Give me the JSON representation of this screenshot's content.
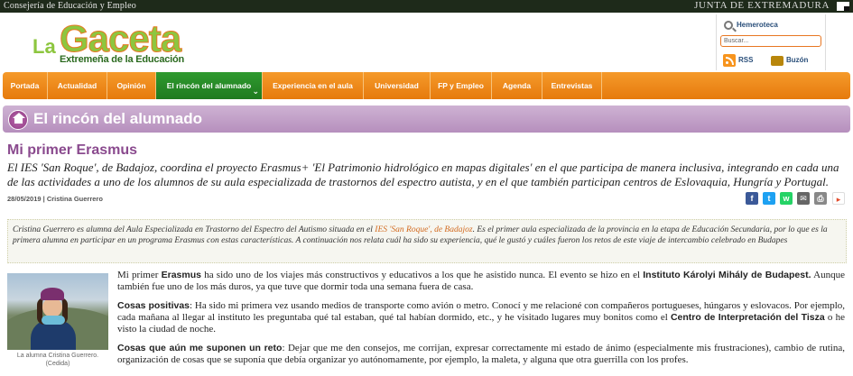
{
  "header": {
    "consejeria": "Consejería de Educación y Empleo",
    "junta": "JUNTA DE EXTREMADURA",
    "logo_la": "La",
    "logo_gaceta": "Gaceta",
    "logo_sub": "Extremeña de la Educación"
  },
  "tools": {
    "hemeroteca": "Hemeroteca",
    "search_placeholder": "Buscar...",
    "rss": "RSS",
    "buzon": "Buzón"
  },
  "nav": [
    {
      "label": "Portada"
    },
    {
      "label": "Actualidad"
    },
    {
      "label": "Opinión"
    },
    {
      "label": "El rincón del alumnado"
    },
    {
      "label": "Experiencia en el aula"
    },
    {
      "label": "Universidad"
    },
    {
      "label": "FP y Empleo"
    },
    {
      "label": "Agenda"
    },
    {
      "label": "Entrevistas"
    }
  ],
  "section": {
    "title": "El rincón del alumnado"
  },
  "article": {
    "title": "Mi primer Erasmus",
    "lead": "El IES 'San Roque', de Badajoz, coordina el proyecto Erasmus+ 'El Patrimonio hidrológico en mapas digitales' en el que participa de manera inclusiva, integrando en cada una de las actividades a uno de los alumnos de su aula especializada de trastornos del espectro autista, y en el que también participan centros de Eslovaquia, Hungría y Portugal.",
    "date": "28/05/2019",
    "separator": " | ",
    "author": "Cristina Guerrero",
    "intro_a": "Cristina Guerrero es alumna del Aula Especializada en Trastorno del Espectro del Autismo situada en el ",
    "intro_link": "IES 'San Roque', de Badajoz",
    "intro_b": ". Es el primer aula especializada de la provincia en la etapa de Educación Secundaria, por lo que es la primera alumna en participar en un programa Erasmus con estas características. A continuación nos relata cuál ha sido su experiencia, qué le gustó y cuáles fueron los retos de este viaje de intercambio celebrado en Budapes",
    "caption": "La alumna Cristina Guerrero. (Cedida)",
    "p1_a": "Mi primer ",
    "p1_b1": "Erasmus",
    "p1_c": " ha sido uno de los viajes más constructivos y educativos a los que he asistido nunca. El evento se hizo en el ",
    "p1_b2": "Instituto Károlyi Mihály de Budapest.",
    "p1_d": " Aunque también fue uno de los más duros, ya que tuve que dormir toda una semana fuera de casa.",
    "p2_b": "Cosas positivas",
    "p2_a": ": Ha sido mi primera vez usando medios de transporte como avión o metro. Conocí y me relacioné con compañeros portugueses, húngaros y eslovacos. Por ejemplo, cada mañana al llegar al instituto les preguntaba qué tal estaban, qué tal habían dormido, etc., y he visitado lugares muy bonitos como el ",
    "p2_b2": "Centro de Interpretación del Tisza",
    "p2_c": " o he visto la ciudad de noche.",
    "p3_b": "Cosas que aún me suponen un reto",
    "p3_a": ": Dejar que me den consejos, me corrijan, expresar correctamente mi estado de ánimo (especialmente mis frustraciones), cambio de rutina, organización de cosas que se suponía que debía organizar yo autónomamente, por ejemplo, la maleta, y alguna que otra guerrilla con los profes."
  },
  "social": [
    {
      "icon": "facebook-icon",
      "color": "#3b5998",
      "glyph": "f"
    },
    {
      "icon": "twitter-icon",
      "color": "#1da1f2",
      "glyph": "t"
    },
    {
      "icon": "whatsapp-icon",
      "color": "#25d366",
      "glyph": "w"
    },
    {
      "icon": "email-icon",
      "color": "#666666",
      "glyph": "✉"
    },
    {
      "icon": "print-icon",
      "color": "#888888",
      "glyph": "⎙"
    },
    {
      "icon": "share-icon",
      "color": "#e24a2a",
      "glyph": "▸"
    }
  ]
}
